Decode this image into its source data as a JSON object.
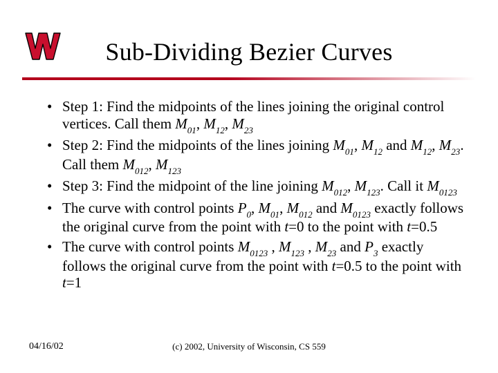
{
  "title": "Sub-Dividing Bezier Curves",
  "bullets": [
    {
      "prefix": "Step 1: Find the midpoints of the lines joining the original control vertices. Call them ",
      "terms": [
        {
          "sym": "M",
          "sub": "01"
        },
        {
          "text": ", "
        },
        {
          "sym": "M",
          "sub": "12"
        },
        {
          "text": ", "
        },
        {
          "sym": "M",
          "sub": "23"
        }
      ]
    },
    {
      "prefix": "Step 2: Find the midpoints of the lines joining ",
      "terms": [
        {
          "sym": "M",
          "sub": "01"
        },
        {
          "text": ", "
        },
        {
          "sym": "M",
          "sub": "12"
        },
        {
          "text": " and "
        },
        {
          "sym": "M",
          "sub": "12"
        },
        {
          "text": ", "
        },
        {
          "sym": "M",
          "sub": "23"
        },
        {
          "text": ". Call them "
        },
        {
          "sym": "M",
          "sub": "012"
        },
        {
          "text": ", "
        },
        {
          "sym": "M",
          "sub": "123"
        }
      ]
    },
    {
      "prefix": "Step 3: Find the midpoint of the line joining ",
      "terms": [
        {
          "sym": "M",
          "sub": "012"
        },
        {
          "text": ", "
        },
        {
          "sym": "M",
          "sub": "123"
        },
        {
          "text": ". Call it "
        },
        {
          "sym": "M",
          "sub": "0123"
        }
      ]
    },
    {
      "prefix": "The curve with control points ",
      "terms": [
        {
          "sym": "P",
          "sub": "0"
        },
        {
          "text": ", "
        },
        {
          "sym": "M",
          "sub": "01"
        },
        {
          "text": ", "
        },
        {
          "sym": "M",
          "sub": "012"
        },
        {
          "text": " and "
        },
        {
          "sym": "M",
          "sub": "0123"
        },
        {
          "text": " exactly follows the original curve from the point with "
        },
        {
          "sym": "t"
        },
        {
          "text": "=0 to the point with "
        },
        {
          "sym": "t"
        },
        {
          "text": "=0.5"
        }
      ]
    },
    {
      "prefix": "The curve with control points ",
      "terms": [
        {
          "sym": "M",
          "sub": "0123"
        },
        {
          "text": " , "
        },
        {
          "sym": "M",
          "sub": "123"
        },
        {
          "text": " , "
        },
        {
          "sym": "M",
          "sub": "23"
        },
        {
          "text": " and "
        },
        {
          "sym": "P",
          "sub": "3"
        },
        {
          "text": " exactly follows the original curve from the point with "
        },
        {
          "sym": "t"
        },
        {
          "text": "=0.5 to the point with "
        },
        {
          "sym": "t"
        },
        {
          "text": "=1"
        }
      ]
    }
  ],
  "footer": {
    "date": "04/16/02",
    "copyright": "(c) 2002, University of Wisconsin, CS 559"
  },
  "logo": {
    "name": "wisconsin-w-logo",
    "colors": {
      "fill": "#c8102e",
      "stroke": "#000000"
    }
  }
}
